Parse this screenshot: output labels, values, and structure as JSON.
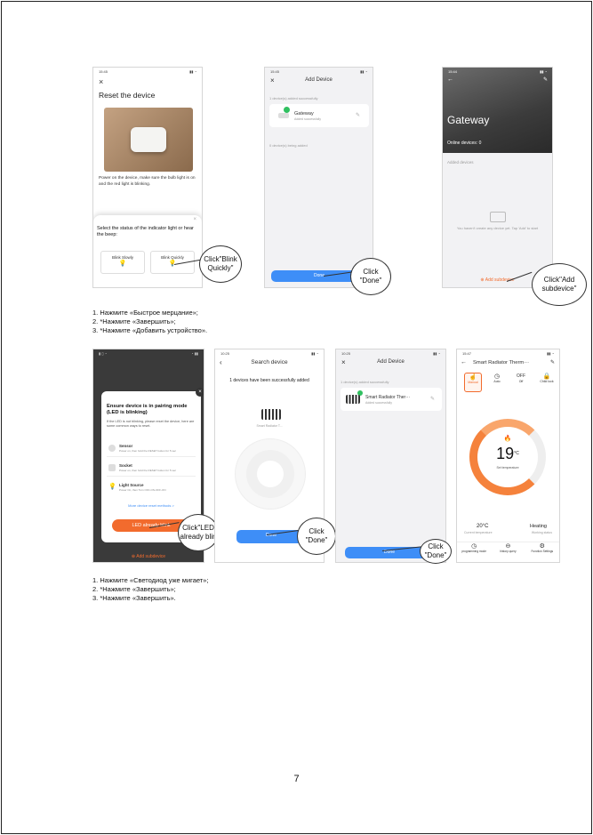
{
  "shot1": {
    "time": "15:45",
    "title": "Reset the device",
    "desc": "Power on the device, make sure the bulb light is on and the red light is blinking.",
    "sheet_title": "Select the status of the indicator light or hear the beep:",
    "opt1": "Blink Slowly",
    "opt2": "Blink Quickly"
  },
  "shot2": {
    "time": "15:45",
    "title": "Add Device",
    "added_label": "1 device(s) added successfully",
    "device_name": "Gateway",
    "device_status": "Added successfully",
    "adding_label": "0 device(s) being added",
    "done": "Done"
  },
  "shot3": {
    "time": "15:44",
    "title": "Gateway",
    "online": "Online devices: 0",
    "added_devices": "Added devices",
    "empty": "You haven't create any device yet. Tap 'Add' to start",
    "add_sub": "Add subdevice"
  },
  "shot4": {
    "modal_title": "Ensure device is in pairing mode (LED is blinking)",
    "modal_desc": "If the LED is not blinking, please reset the device, here are some common ways to reset.",
    "item1_title": "Sensor",
    "item1_desc": "Power on, then hold the RESET button for 5 sec",
    "item2_title": "Socket",
    "item2_desc": "Power on, then hold the RESET button for 5 sec",
    "item3_title": "Light Source",
    "item3_desc": "Power On, then Turn OFF-ON-OFF-ON",
    "more_link": "More device reset methods >",
    "led_btn": "LED already blink",
    "add_sub": "Add subdevice"
  },
  "shot5": {
    "time": "10:25",
    "title": "Search device",
    "success": "1 devices have been successfully added",
    "device_label": "Smart Radiator T...",
    "done": "Done"
  },
  "shot6": {
    "time": "10:25",
    "title": "Add Device",
    "added_label": "1 device(s) added successfully",
    "device_name": "Smart Radiator Ther···",
    "device_status": "Added successfully",
    "done": "Done"
  },
  "shot7": {
    "time": "15:47",
    "title": "Smart Radiator Therm···",
    "mode1": "Manual",
    "mode2": "Auto",
    "mode3": "Off",
    "mode4": "Child lock",
    "temp": "19",
    "unit": "°C",
    "set_label": "Set temperature",
    "cur_temp": "20°C",
    "cur_label": "Current temperature",
    "status": "Heating",
    "status_label": "Working status",
    "nav1": "programming mode",
    "nav2": "history query",
    "nav3": "Function Settings"
  },
  "callouts": {
    "c1": "Click\"Blink Quickly\"",
    "c2": "Click \"Done\"",
    "c3": "Click\"Add subdevice\"",
    "c4": "Click\"LED already blin",
    "c5": "Click \"Done\"",
    "c6": "Click \"Done\""
  },
  "instructions1": [
    "1. Нажмите «Быстрое мерцание»;",
    "2. *Нажмите «Завершить»;",
    "3. *Нажмите «Добавить устройство»."
  ],
  "instructions2": [
    "1. Нажмите «Светодиод уже мигает»;",
    "2. *Нажмите «Завершить»;",
    "3. *Нажмите «Завершить»."
  ],
  "page_number": "7"
}
